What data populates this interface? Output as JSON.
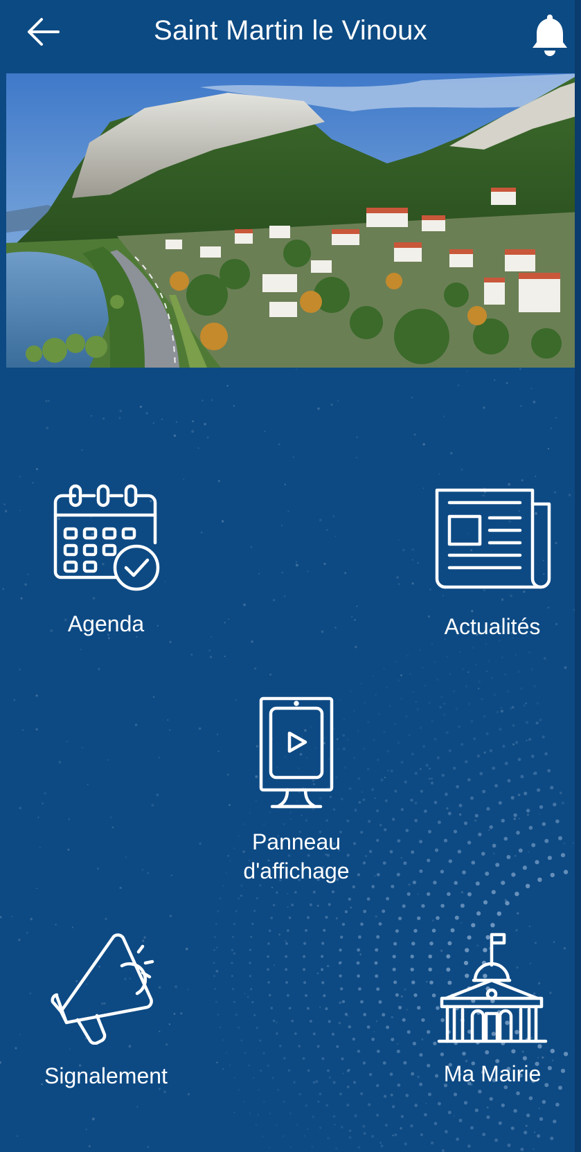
{
  "header": {
    "title": "Saint Martin le Vinoux",
    "back_icon": "arrow-left-icon",
    "notification_icon": "bell-icon"
  },
  "hero": {
    "kind": "photo"
  },
  "menu": {
    "items": [
      {
        "id": "agenda",
        "label": "Agenda",
        "icon": "calendar-check-icon"
      },
      {
        "id": "actualites",
        "label": "Actualités",
        "icon": "newspaper-icon"
      },
      {
        "id": "panneau",
        "label_line1": "Panneau",
        "label_line2": "d'affichage",
        "icon": "billboard-play-icon"
      },
      {
        "id": "signalement",
        "label": "Signalement",
        "icon": "megaphone-icon"
      },
      {
        "id": "mairie",
        "label": "Ma Mairie",
        "icon": "town-hall-icon"
      }
    ]
  },
  "colors": {
    "primary": "#0c4a83",
    "icon": "#ffffff"
  }
}
